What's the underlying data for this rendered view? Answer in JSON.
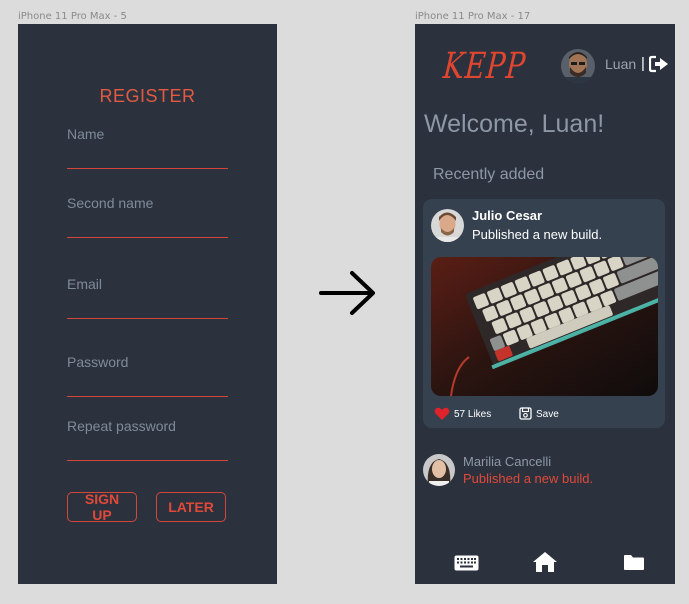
{
  "frames": {
    "left_label": "iPhone 11 Pro Max - 5",
    "right_label": "iPhone 11 Pro Max - 17"
  },
  "register": {
    "title": "REGISTER",
    "fields": [
      {
        "label": "Name"
      },
      {
        "label": "Second name"
      },
      {
        "label": "Email"
      },
      {
        "label": "Password"
      },
      {
        "label": "Repeat password"
      }
    ],
    "signup_label": "SIGN UP",
    "later_label": "LATER"
  },
  "feed": {
    "logo_text": "KEPP",
    "username": "Luan",
    "separator": "|",
    "welcome": "Welcome, Luan!",
    "section_title": "Recently added",
    "posts": [
      {
        "author": "Julio Cesar",
        "action": "Published a new build.",
        "likes": "57 Likes",
        "save_label": "Save"
      },
      {
        "author": "Marilia Cancelli",
        "action": "Published a new build."
      }
    ],
    "nav": [
      "keyboard-icon",
      "home-icon",
      "folder-icon"
    ]
  },
  "colors": {
    "background": "#dcdcdc",
    "screen": "#2b323d",
    "card": "#35414f",
    "accent": "#e0493a",
    "muted_text": "#8d97a6"
  }
}
